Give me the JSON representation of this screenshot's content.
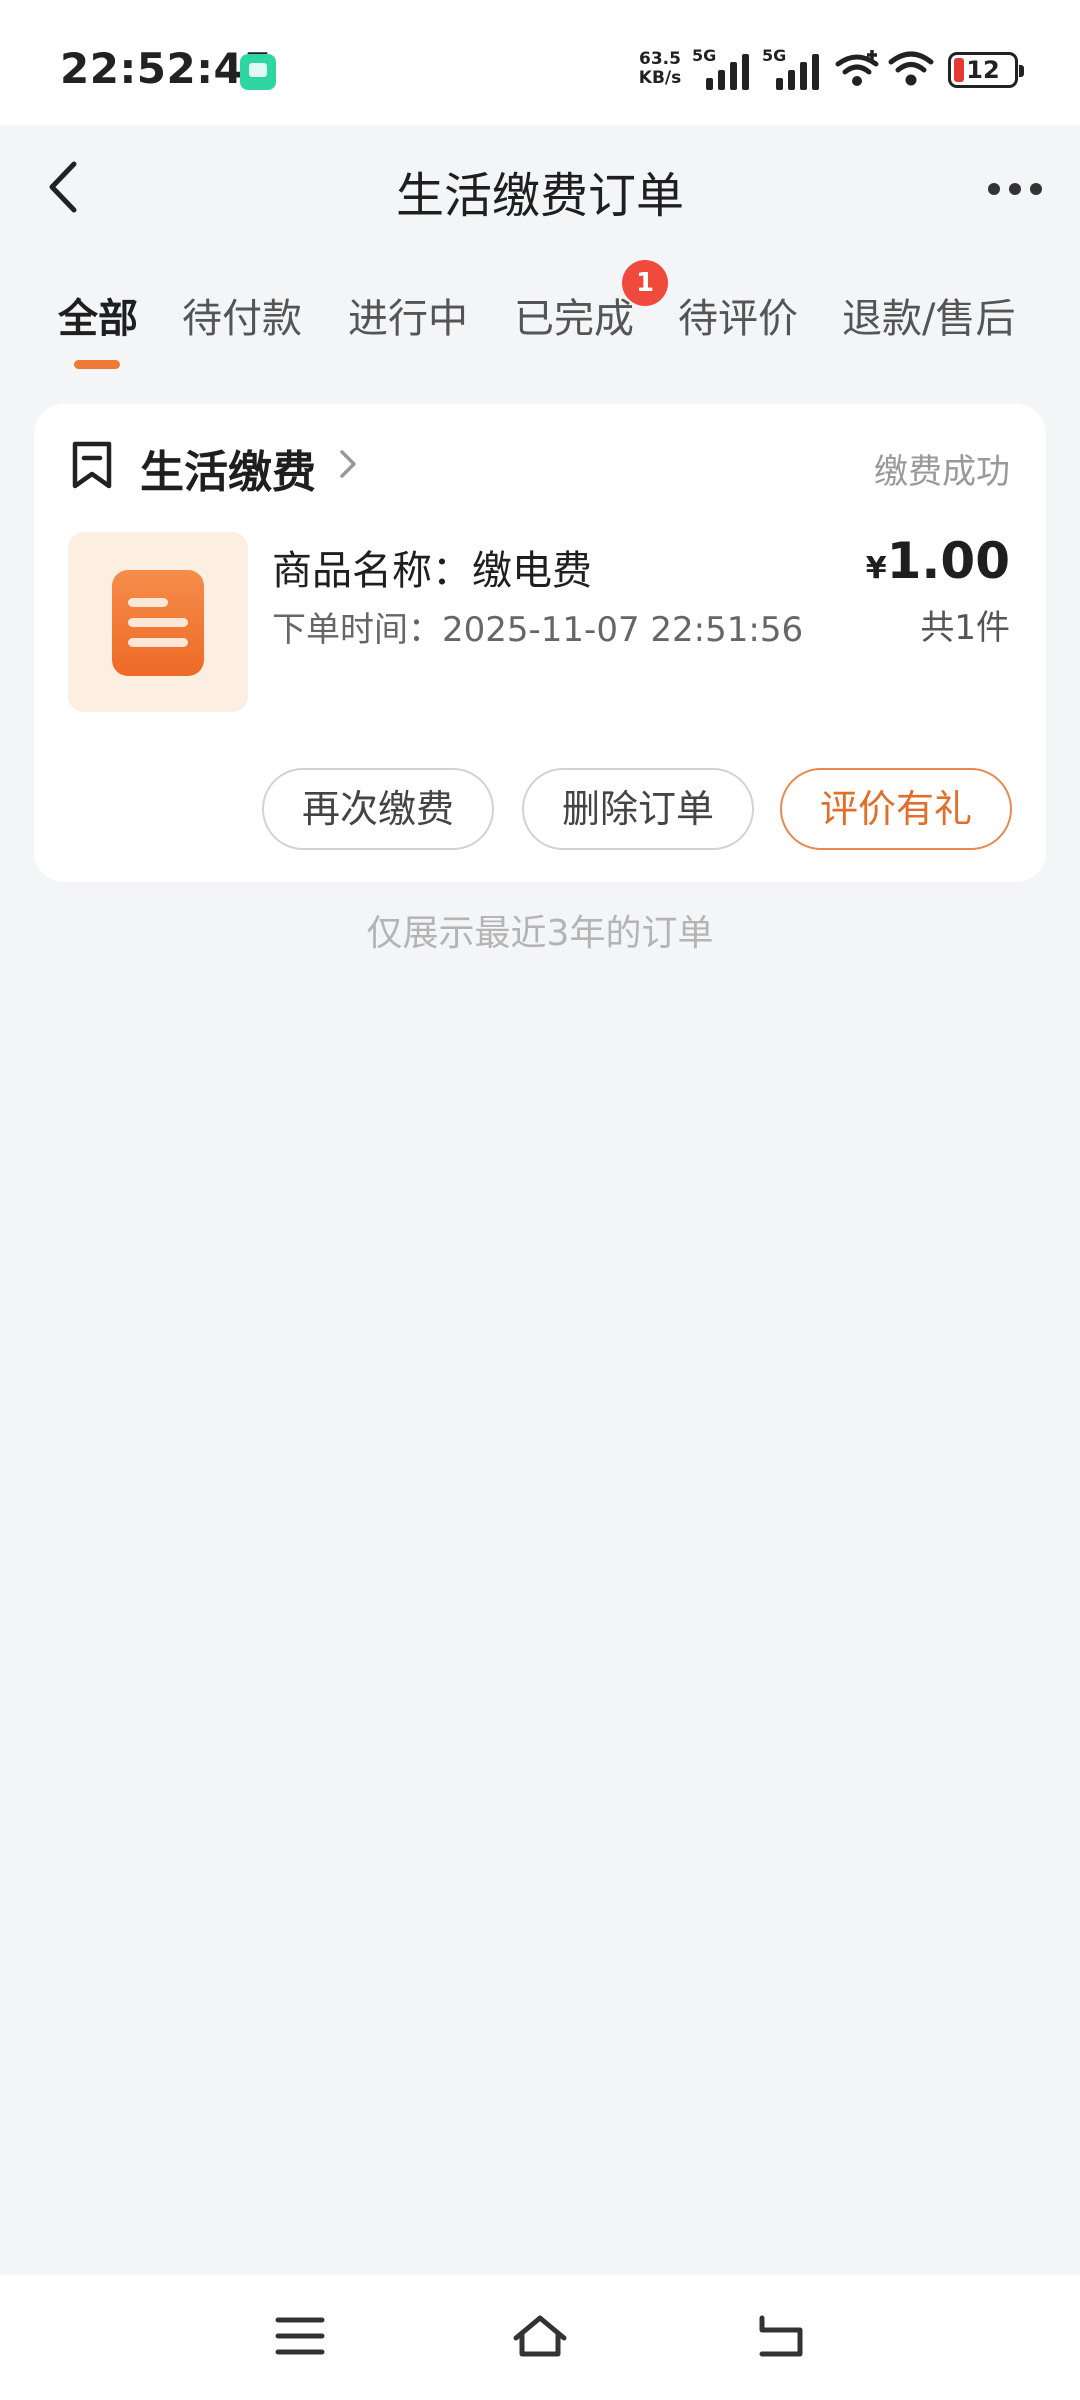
{
  "status_bar": {
    "time": "22:52:45",
    "net_speed_value": "63.5",
    "net_speed_unit": "KB/s",
    "signal_1": "5G",
    "signal_2": "5G",
    "battery": "12"
  },
  "header": {
    "title": "生活缴费订单"
  },
  "tabs": [
    {
      "label": "全部",
      "active": true
    },
    {
      "label": "待付款"
    },
    {
      "label": "进行中"
    },
    {
      "label": "已完成",
      "badge": "1"
    },
    {
      "label": "待评价"
    },
    {
      "label": "退款/售后"
    }
  ],
  "order": {
    "shop_name": "生活缴费",
    "status": "缴费成功",
    "product_name": "商品名称：缴电费",
    "order_time": "下单时间：2025-11-07 22:51:56",
    "currency": "¥",
    "price": "1.00",
    "quantity": "共1件",
    "buttons": {
      "repay": "再次缴费",
      "delete": "删除订单",
      "review": "评价有礼"
    }
  },
  "footer_note": "仅展示最近3年的订单",
  "colors": {
    "accent": "#ef7a35",
    "badge": "#ef4a3c",
    "background": "#f4f5f7"
  }
}
